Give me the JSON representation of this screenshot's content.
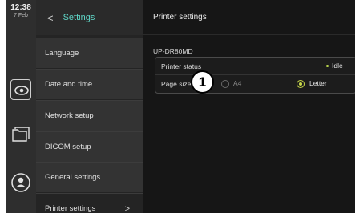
{
  "status_bar": {
    "time": "12:38",
    "date": "7 Feb"
  },
  "rail": {
    "icons": [
      "live-view-icon",
      "files-icon",
      "user-icon"
    ]
  },
  "menu": {
    "back_label": "<",
    "title": "Settings",
    "items": [
      {
        "label": "Language"
      },
      {
        "label": "Date and time"
      },
      {
        "label": "Network setup"
      },
      {
        "label": "DICOM setup"
      },
      {
        "label": "General settings"
      },
      {
        "label": "Printer settings",
        "active": true,
        "chevron": ">"
      }
    ]
  },
  "main": {
    "title": "Printer settings",
    "printer_name": "UP-DR80MD",
    "status_label": "Printer status",
    "status_value": "Idle",
    "status_color": "#b9d64c",
    "page_size_label": "Page size",
    "page_size_options": [
      {
        "label": "A4",
        "selected": false
      },
      {
        "label": "Letter",
        "selected": true
      }
    ]
  },
  "callout": {
    "number": "1"
  },
  "colors": {
    "accent": "#5fd6c7",
    "selected_radio": "#c9d94a"
  }
}
